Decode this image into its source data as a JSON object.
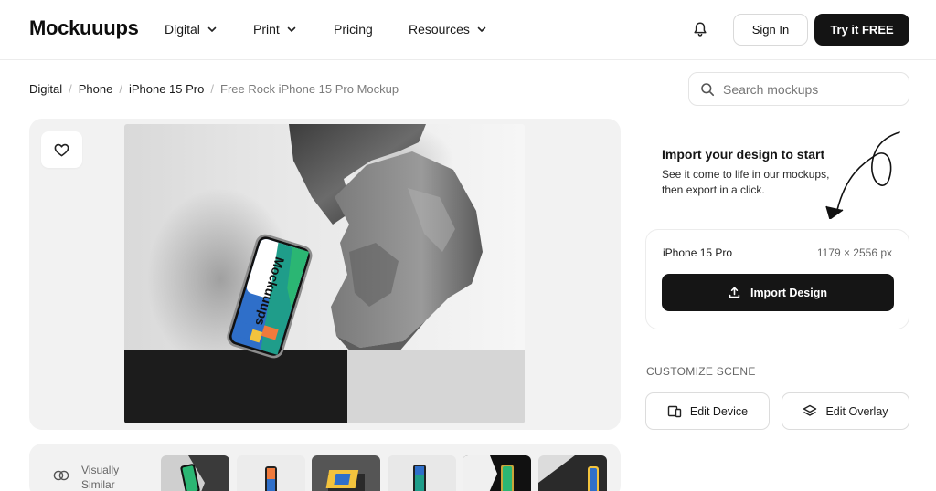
{
  "header": {
    "logo": "Mockuuups",
    "nav": [
      {
        "label": "Digital",
        "has_dropdown": true
      },
      {
        "label": "Print",
        "has_dropdown": true
      },
      {
        "label": "Pricing",
        "has_dropdown": false
      },
      {
        "label": "Resources",
        "has_dropdown": true
      }
    ],
    "bell_icon": "bell-icon",
    "sign_in": "Sign In",
    "try_free": "Try it FREE"
  },
  "breadcrumb": {
    "items": [
      "Digital",
      "Phone",
      "iPhone 15 Pro"
    ],
    "current": "Free Rock iPhone 15 Pro Mockup"
  },
  "search": {
    "placeholder": "Search mockups",
    "value": ""
  },
  "preview": {
    "favorite_icon": "heart-icon",
    "phone_brand_text": "Mockuuups"
  },
  "import_panel": {
    "title": "Import your design to start",
    "subtitle": "See it come to life in our mockups, then export in a click.",
    "device_name": "iPhone 15 Pro",
    "resolution": "1179 × 2556 px",
    "import_button": "Import Design",
    "import_icon": "upload-icon"
  },
  "customize": {
    "label": "CUSTOMIZE SCENE",
    "edit_device": "Edit Device",
    "edit_overlay": "Edit Overlay",
    "edit_device_icon": "devices-icon",
    "edit_overlay_icon": "layers-icon"
  },
  "similar": {
    "label_line1": "Visually",
    "label_line2": "Similar",
    "icon": "overlap-circles-icon"
  },
  "colors": {
    "accent_dark": "#141414",
    "screen_blue": "#2f6fc9",
    "screen_teal": "#1f9d8a",
    "screen_green": "#2bb673",
    "screen_orange": "#f07a3c",
    "screen_yellow": "#f3c33d"
  }
}
